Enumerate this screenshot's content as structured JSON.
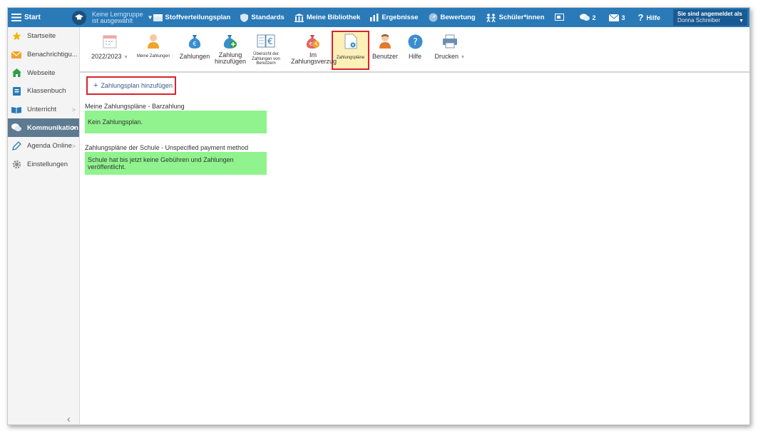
{
  "topbar": {
    "start_label": "Start",
    "group_line1": "Keine Lerngruppe",
    "group_line2": "ist ausgewählt",
    "nav": [
      {
        "label": "Stoffverteilungsplan"
      },
      {
        "label": "Standards"
      },
      {
        "label": "Meine Bibliothek"
      },
      {
        "label": "Ergebnisse"
      },
      {
        "label": "Bewertung"
      },
      {
        "label": "Schüler*innen"
      }
    ],
    "chat_count": "2",
    "mail_count": "3",
    "help_label": "Hilfe",
    "user_line1": "Sie sind angemeldet als",
    "user_name": "Donna Schreiber"
  },
  "sidebar": {
    "items": [
      {
        "label": "Startseite",
        "icon": "star-icon"
      },
      {
        "label": "Benachrichtigu...",
        "icon": "envelope-icon"
      },
      {
        "label": "Webseite",
        "icon": "house-icon"
      },
      {
        "label": "Klassenbuch",
        "icon": "book-icon"
      },
      {
        "label": "Unterricht",
        "icon": "open-book-icon"
      },
      {
        "label": "Kommunikation",
        "icon": "chat-icon"
      },
      {
        "label": "Agenda Online",
        "icon": "pen-icon"
      },
      {
        "label": "Einstellungen",
        "icon": "gear-icon"
      }
    ]
  },
  "toolbar": {
    "year": "2022/2023",
    "my_payments": "Meine Zahlungen",
    "payments": "Zahlungen",
    "add_payment_1": "Zahlung",
    "add_payment_2": "hinzufügen",
    "overview_1": "Übersicht der",
    "overview_2": "Zahlungen von",
    "overview_3": "Benutzern",
    "overdue_1": "Im",
    "overdue_2": "Zahlungsverzug",
    "plans": "Zahlungspläne",
    "users": "Benutzer",
    "help": "Hilfe",
    "print": "Drucken"
  },
  "content": {
    "add_plan": "Zahlungsplan hinzufügen",
    "section1_title": "Meine Zahlungspläne - Barzahlung",
    "section1_msg": "Kein Zahlungsplan.",
    "section2_title": "Zahlungspläne der Schule - Unspecified payment method",
    "section2_msg": "Schule hat bis jetzt keine Gebühren und Zahlungen veröffentlicht."
  },
  "colors": {
    "topbar": "#2a7ab8",
    "active_sidebar": "#5e7a91",
    "highlight_red": "#d9232d",
    "info_green": "#90f38e",
    "selected_tool": "#fdf0b8"
  }
}
